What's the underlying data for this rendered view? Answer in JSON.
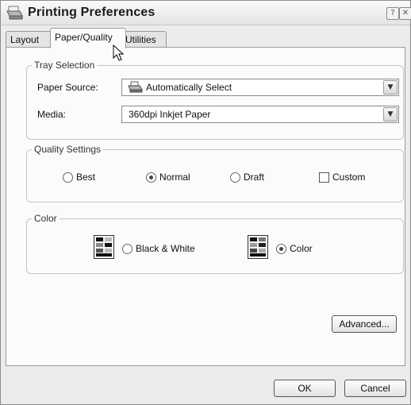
{
  "window": {
    "title": "Printing Preferences",
    "help_glyph": "?",
    "close_glyph": "✕"
  },
  "tabs": [
    {
      "label": "Layout",
      "active": false
    },
    {
      "label": "Paper/Quality",
      "active": true
    },
    {
      "label": "Utilities",
      "active": false
    }
  ],
  "tray_selection": {
    "legend": "Tray Selection",
    "paper_source": {
      "label": "Paper Source:",
      "value": "Automatically Select",
      "icon": "printer-icon"
    },
    "media": {
      "label": "Media:",
      "value": "360dpi Inkjet Paper"
    }
  },
  "quality_settings": {
    "legend": "Quality Settings",
    "options": [
      {
        "label": "Best",
        "selected": false
      },
      {
        "label": "Normal",
        "selected": true
      },
      {
        "label": "Draft",
        "selected": false
      }
    ],
    "custom": {
      "label": "Custom",
      "checked": false
    }
  },
  "color": {
    "legend": "Color",
    "options": [
      {
        "label": "Black & White",
        "selected": false,
        "icon": "bw-cartridge-icon"
      },
      {
        "label": "Color",
        "selected": true,
        "icon": "color-cartridge-icon"
      }
    ]
  },
  "buttons": {
    "advanced": "Advanced...",
    "ok": "OK",
    "cancel": "Cancel"
  },
  "dropdown_glyph": "▼"
}
